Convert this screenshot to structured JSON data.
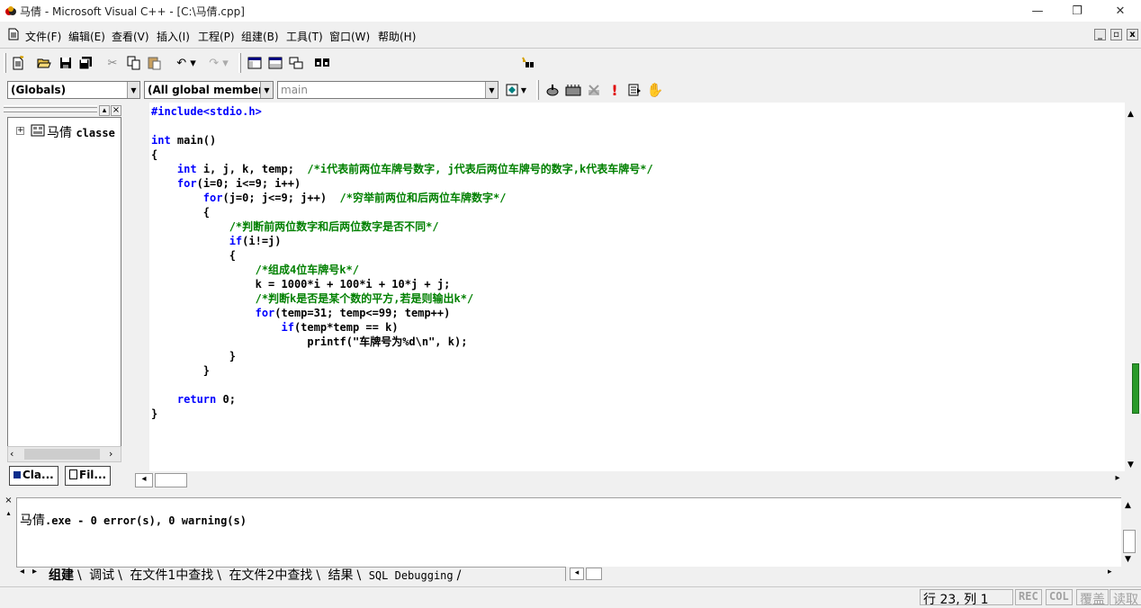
{
  "window": {
    "title": "马倩 - Microsoft Visual C++ - [C:\\马倩.cpp]",
    "minimize_glyph": "—",
    "restore_glyph": "❐",
    "close_glyph": "✕"
  },
  "menu": {
    "items": [
      {
        "label": "文件(F)"
      },
      {
        "label": "编辑(E)"
      },
      {
        "label": "查看(V)"
      },
      {
        "label": "插入(I)"
      },
      {
        "label": "工程(P)"
      },
      {
        "label": "组建(B)"
      },
      {
        "label": "工具(T)"
      },
      {
        "label": "窗口(W)"
      },
      {
        "label": "帮助(H)"
      }
    ],
    "mdi_minimize": "_",
    "mdi_restore": "▫",
    "mdi_close": "x"
  },
  "toolbar": {
    "find_value": "",
    "icons": [
      "new-file-icon",
      "open-folder-icon",
      "save-icon",
      "save-all-icon",
      "cut-icon",
      "copy-icon",
      "paste-icon",
      "undo-icon",
      "redo-icon",
      "workspace-icon",
      "output-window-icon",
      "window-list-icon",
      "find-in-files-icon",
      "find-icon"
    ]
  },
  "wizardbar": {
    "class_combo": "(Globals)",
    "filter_combo": "(All global members",
    "member_combo": "main",
    "icons": [
      "action-icon",
      "compile-icon",
      "build-icon",
      "stop-build-icon",
      "execute-icon",
      "go-icon",
      "breakpoint-icon"
    ]
  },
  "workspace": {
    "tree_item_label": "马倩",
    "tree_item_suffix": "classe",
    "tab_class": "Cla...",
    "tab_file": "Fil..."
  },
  "code": {
    "lines": [
      {
        "kind": "pp",
        "text": "#include<stdio.h>"
      },
      {
        "kind": "plain",
        "text": ""
      },
      {
        "kind": "mixed",
        "parts": [
          {
            "c": "kw",
            "t": "int"
          },
          {
            "c": "",
            "t": " main()"
          }
        ]
      },
      {
        "kind": "plain",
        "text": "{"
      },
      {
        "kind": "mixed",
        "parts": [
          {
            "c": "",
            "t": "    "
          },
          {
            "c": "kw",
            "t": "int"
          },
          {
            "c": "",
            "t": " i, j, k, temp;  "
          },
          {
            "c": "cm",
            "t": "/*i代表前两位车牌号数字, j代表后两位车牌号的数字,k代表车牌号*/"
          }
        ]
      },
      {
        "kind": "mixed",
        "parts": [
          {
            "c": "",
            "t": "    "
          },
          {
            "c": "kw",
            "t": "for"
          },
          {
            "c": "",
            "t": "(i=0; i<=9; i++)"
          }
        ]
      },
      {
        "kind": "mixed",
        "parts": [
          {
            "c": "",
            "t": "        "
          },
          {
            "c": "kw",
            "t": "for"
          },
          {
            "c": "",
            "t": "(j=0; j<=9; j++)  "
          },
          {
            "c": "cm",
            "t": "/*穷举前两位和后两位车牌数字*/"
          }
        ]
      },
      {
        "kind": "plain",
        "text": "        {"
      },
      {
        "kind": "mixed",
        "parts": [
          {
            "c": "",
            "t": "            "
          },
          {
            "c": "cm",
            "t": "/*判断前两位数字和后两位数字是否不同*/"
          }
        ]
      },
      {
        "kind": "mixed",
        "parts": [
          {
            "c": "",
            "t": "            "
          },
          {
            "c": "kw",
            "t": "if"
          },
          {
            "c": "",
            "t": "(i!=j)"
          }
        ]
      },
      {
        "kind": "plain",
        "text": "            {"
      },
      {
        "kind": "mixed",
        "parts": [
          {
            "c": "",
            "t": "                "
          },
          {
            "c": "cm",
            "t": "/*组成4位车牌号k*/"
          }
        ]
      },
      {
        "kind": "plain",
        "text": "                k = 1000*i + 100*i + 10*j + j;"
      },
      {
        "kind": "mixed",
        "parts": [
          {
            "c": "",
            "t": "                "
          },
          {
            "c": "cm",
            "t": "/*判断k是否是某个数的平方,若是则输出k*/"
          }
        ]
      },
      {
        "kind": "mixed",
        "parts": [
          {
            "c": "",
            "t": "                "
          },
          {
            "c": "kw",
            "t": "for"
          },
          {
            "c": "",
            "t": "(temp=31; temp<=99; temp++)"
          }
        ]
      },
      {
        "kind": "mixed",
        "parts": [
          {
            "c": "",
            "t": "                    "
          },
          {
            "c": "kw",
            "t": "if"
          },
          {
            "c": "",
            "t": "(temp*temp == k)"
          }
        ]
      },
      {
        "kind": "plain",
        "text": "                        printf(\"车牌号为%d\\n\", k);"
      },
      {
        "kind": "plain",
        "text": "            }"
      },
      {
        "kind": "plain",
        "text": "        }"
      },
      {
        "kind": "plain",
        "text": ""
      },
      {
        "kind": "mixed",
        "parts": [
          {
            "c": "",
            "t": "    "
          },
          {
            "c": "kw",
            "t": "return"
          },
          {
            "c": "",
            "t": " 0;"
          }
        ]
      },
      {
        "kind": "plain",
        "text": "}"
      }
    ]
  },
  "output": {
    "name_part": "马倩",
    "message_part": ".exe - 0 error(s), 0 warning(s)",
    "tabs": [
      "组建",
      "调试",
      "在文件1中查找",
      "在文件2中查找",
      "结果",
      "SQL Debugging"
    ]
  },
  "status": {
    "position": "行 23, 列 1",
    "rec": "REC",
    "col": "COL",
    "ovr": "覆盖",
    "read": "读取"
  },
  "colors": {
    "keyword": "#0000ff",
    "comment": "#008000",
    "text": "#000000"
  }
}
